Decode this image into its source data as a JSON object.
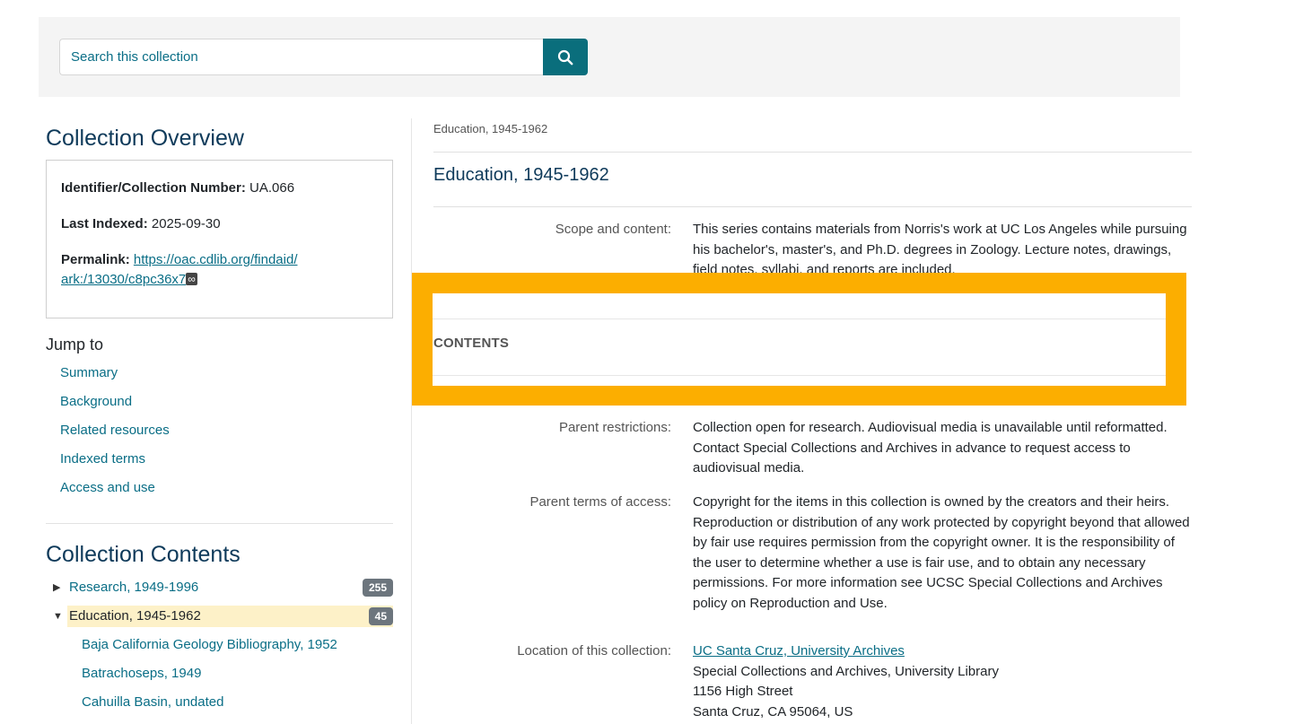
{
  "search": {
    "placeholder": "Search this collection",
    "button_icon": "search-icon"
  },
  "overview": {
    "title": "Collection Overview",
    "identifier_label": "Identifier/Collection Number:",
    "identifier_value": "UA.066",
    "indexed_label": "Last Indexed:",
    "indexed_value": "2025-09-30",
    "permalink_label": "Permalink:",
    "permalink_line1": "https://oac.cdlib.org/findaid/",
    "permalink_line2": "ark:/13030/c8pc36x7",
    "permalink_icon": "infinity-icon"
  },
  "jump": {
    "title": "Jump to",
    "items": [
      "Summary",
      "Background",
      "Related resources",
      "Indexed terms",
      "Access and use"
    ]
  },
  "contents": {
    "title": "Collection Contents",
    "items": [
      {
        "label": "Research, 1949-1996",
        "count": "255",
        "expanded": false
      },
      {
        "label": "Education, 1945-1962",
        "count": "45",
        "expanded": true
      }
    ],
    "children": [
      "Baja California Geology Bibliography, 1952",
      "Batrachoseps, 1949",
      "Cahuilla Basin, undated"
    ]
  },
  "main": {
    "breadcrumb": "Education, 1945-1962",
    "title": "Education, 1945-1962",
    "scope_label": "Scope and content:",
    "scope_value": "This series contains materials from Norris's work at UC Los Angeles while pursuing his bachelor's, master's, and Ph.D. degrees in Zoology. Lecture notes, drawings, field notes, syllabi, and reports are included.",
    "contents_heading": "CONTENTS",
    "restrictions_label": "Parent restrictions:",
    "restrictions_value": "Collection open for research. Audiovisual media is unavailable until reformatted. Contact Special Collections and Archives in advance to request access to audiovisual media.",
    "terms_label": "Parent terms of access:",
    "terms_value": "Copyright for the items in this collection is owned by the creators and their heirs. Reproduction or distribution of any work protected by copyright beyond that allowed by fair use requires permission from the copyright owner. It is the responsibility of the user to determine whether a use is fair use, and to obtain any necessary permissions. For more information see UCSC Special Collections and Archives policy on Reproduction and Use.",
    "location_label": "Location of this collection:",
    "location_link": "UC Santa Cruz, University Archives",
    "location_line2": "Special Collections and Archives, University Library",
    "location_line3": "1156 High Street",
    "location_line4": "Santa Cruz, CA 95064, US"
  },
  "colors": {
    "accent": "#0a6e7c",
    "highlight_overlay": "#fcae00",
    "active_row": "#fdf1c8"
  }
}
